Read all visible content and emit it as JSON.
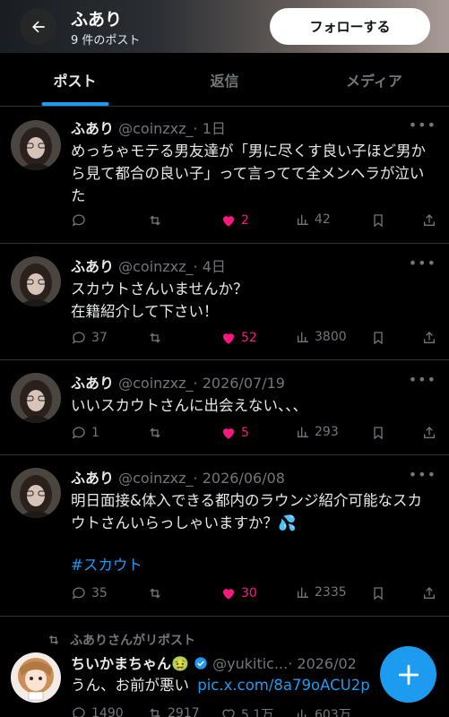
{
  "header": {
    "name": "ふあり",
    "post_count": "9 件のポスト",
    "follow_label": "フォローする"
  },
  "tabs": [
    {
      "label": "ポスト",
      "active": true
    },
    {
      "label": "返信",
      "active": false
    },
    {
      "label": "メディア",
      "active": false
    }
  ],
  "posts": [
    {
      "name": "ふあり",
      "handle": "@coinzxz_",
      "time": "· 1日",
      "text": "めっちゃモテる男友達が「男に尽くす良い子ほど男から見て都合の良い子」って言ってて全メンヘラが泣いた",
      "replies": "",
      "reposts": "",
      "likes": "2",
      "views": "42",
      "liked": true
    },
    {
      "name": "ふあり",
      "handle": "@coinzxz_",
      "time": "· 4日",
      "text": "スカウトさんいませんか？\n在籍紹介して下さい！",
      "replies": "37",
      "reposts": "",
      "likes": "52",
      "views": "3800",
      "liked": true
    },
    {
      "name": "ふあり",
      "handle": "@coinzxz_",
      "time": "· 2026/07/19",
      "text": "いいスカウトさんに出会えない、、、",
      "replies": "1",
      "reposts": "",
      "likes": "5",
      "views": "293",
      "liked": true
    },
    {
      "name": "ふあり",
      "handle": "@coinzxz_",
      "time": "· 2026/06/08",
      "text": "明日面接&体入できる都内のラウンジ紹介可能なスカウトさんいらっしゃいますか？💦",
      "hashtag": "#スカウト",
      "replies": "35",
      "reposts": "",
      "likes": "30",
      "views": "2335",
      "liked": true
    }
  ],
  "repost": {
    "label": "ふありさんがリポスト",
    "name": "ちいかまちゃん",
    "handle": "@yukitic...",
    "time": "· 2026/02",
    "text": "うん、お前が悪い",
    "link": "pic.x.com/8a79oACU2p",
    "replies": "1490",
    "reposts": "2917",
    "likes": "5.1万",
    "views": "603万",
    "badge_emoji": "🤢"
  },
  "icons": {
    "back": "arrow-left-icon",
    "reply": "speech-bubble-icon",
    "repost": "repost-arrows-icon",
    "like": "heart-icon",
    "views": "bar-chart-icon",
    "bookmark": "bookmark-icon",
    "share": "share-upload-icon",
    "more": "more-dots-icon",
    "verified": "verified-badge-icon",
    "compose": "plus-icon"
  },
  "colors": {
    "accent": "#1d9bf0",
    "like": "#f91880",
    "muted": "#71767b",
    "background": "#000000"
  }
}
